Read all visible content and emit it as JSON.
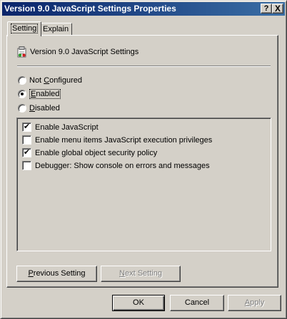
{
  "window": {
    "title": "Version 9.0 JavaScript Settings Properties",
    "help_glyph": "?",
    "close_glyph": "X"
  },
  "tabs": [
    {
      "label": "Setting",
      "active": true
    },
    {
      "label": "Explain",
      "active": false
    }
  ],
  "policy": {
    "name": "Version 9.0 JavaScript Settings",
    "icon": "policy-settings-icon"
  },
  "state_options": [
    {
      "label_pre": "Not ",
      "label_ul": "C",
      "label_post": "onfigured",
      "selected": false
    },
    {
      "label_pre": "",
      "label_ul": "E",
      "label_post": "nabled",
      "selected": true
    },
    {
      "label_pre": "",
      "label_ul": "D",
      "label_post": "isabled",
      "selected": false
    }
  ],
  "checkboxes": [
    {
      "label": "Enable JavaScript",
      "checked": true,
      "mark": "✔"
    },
    {
      "label": "Enable menu items JavaScript execution privileges",
      "checked": false,
      "mark": ""
    },
    {
      "label": "Enable global object security policy",
      "checked": true,
      "mark": "✔"
    },
    {
      "label": "Debugger: Show console on errors and messages",
      "checked": false,
      "mark": ""
    }
  ],
  "nav": {
    "previous": {
      "label_ul": "P",
      "label_rest": "revious Setting",
      "enabled": true
    },
    "next": {
      "label_ul": "N",
      "label_rest": "ext Setting",
      "enabled": false
    }
  },
  "footer": {
    "ok": "OK",
    "cancel": "Cancel",
    "apply": {
      "label_ul": "A",
      "label_rest": "pply",
      "enabled": false
    }
  },
  "colors": {
    "title_start": "#0a246a",
    "title_end": "#3a6ea5",
    "face": "#d4d0c8"
  }
}
